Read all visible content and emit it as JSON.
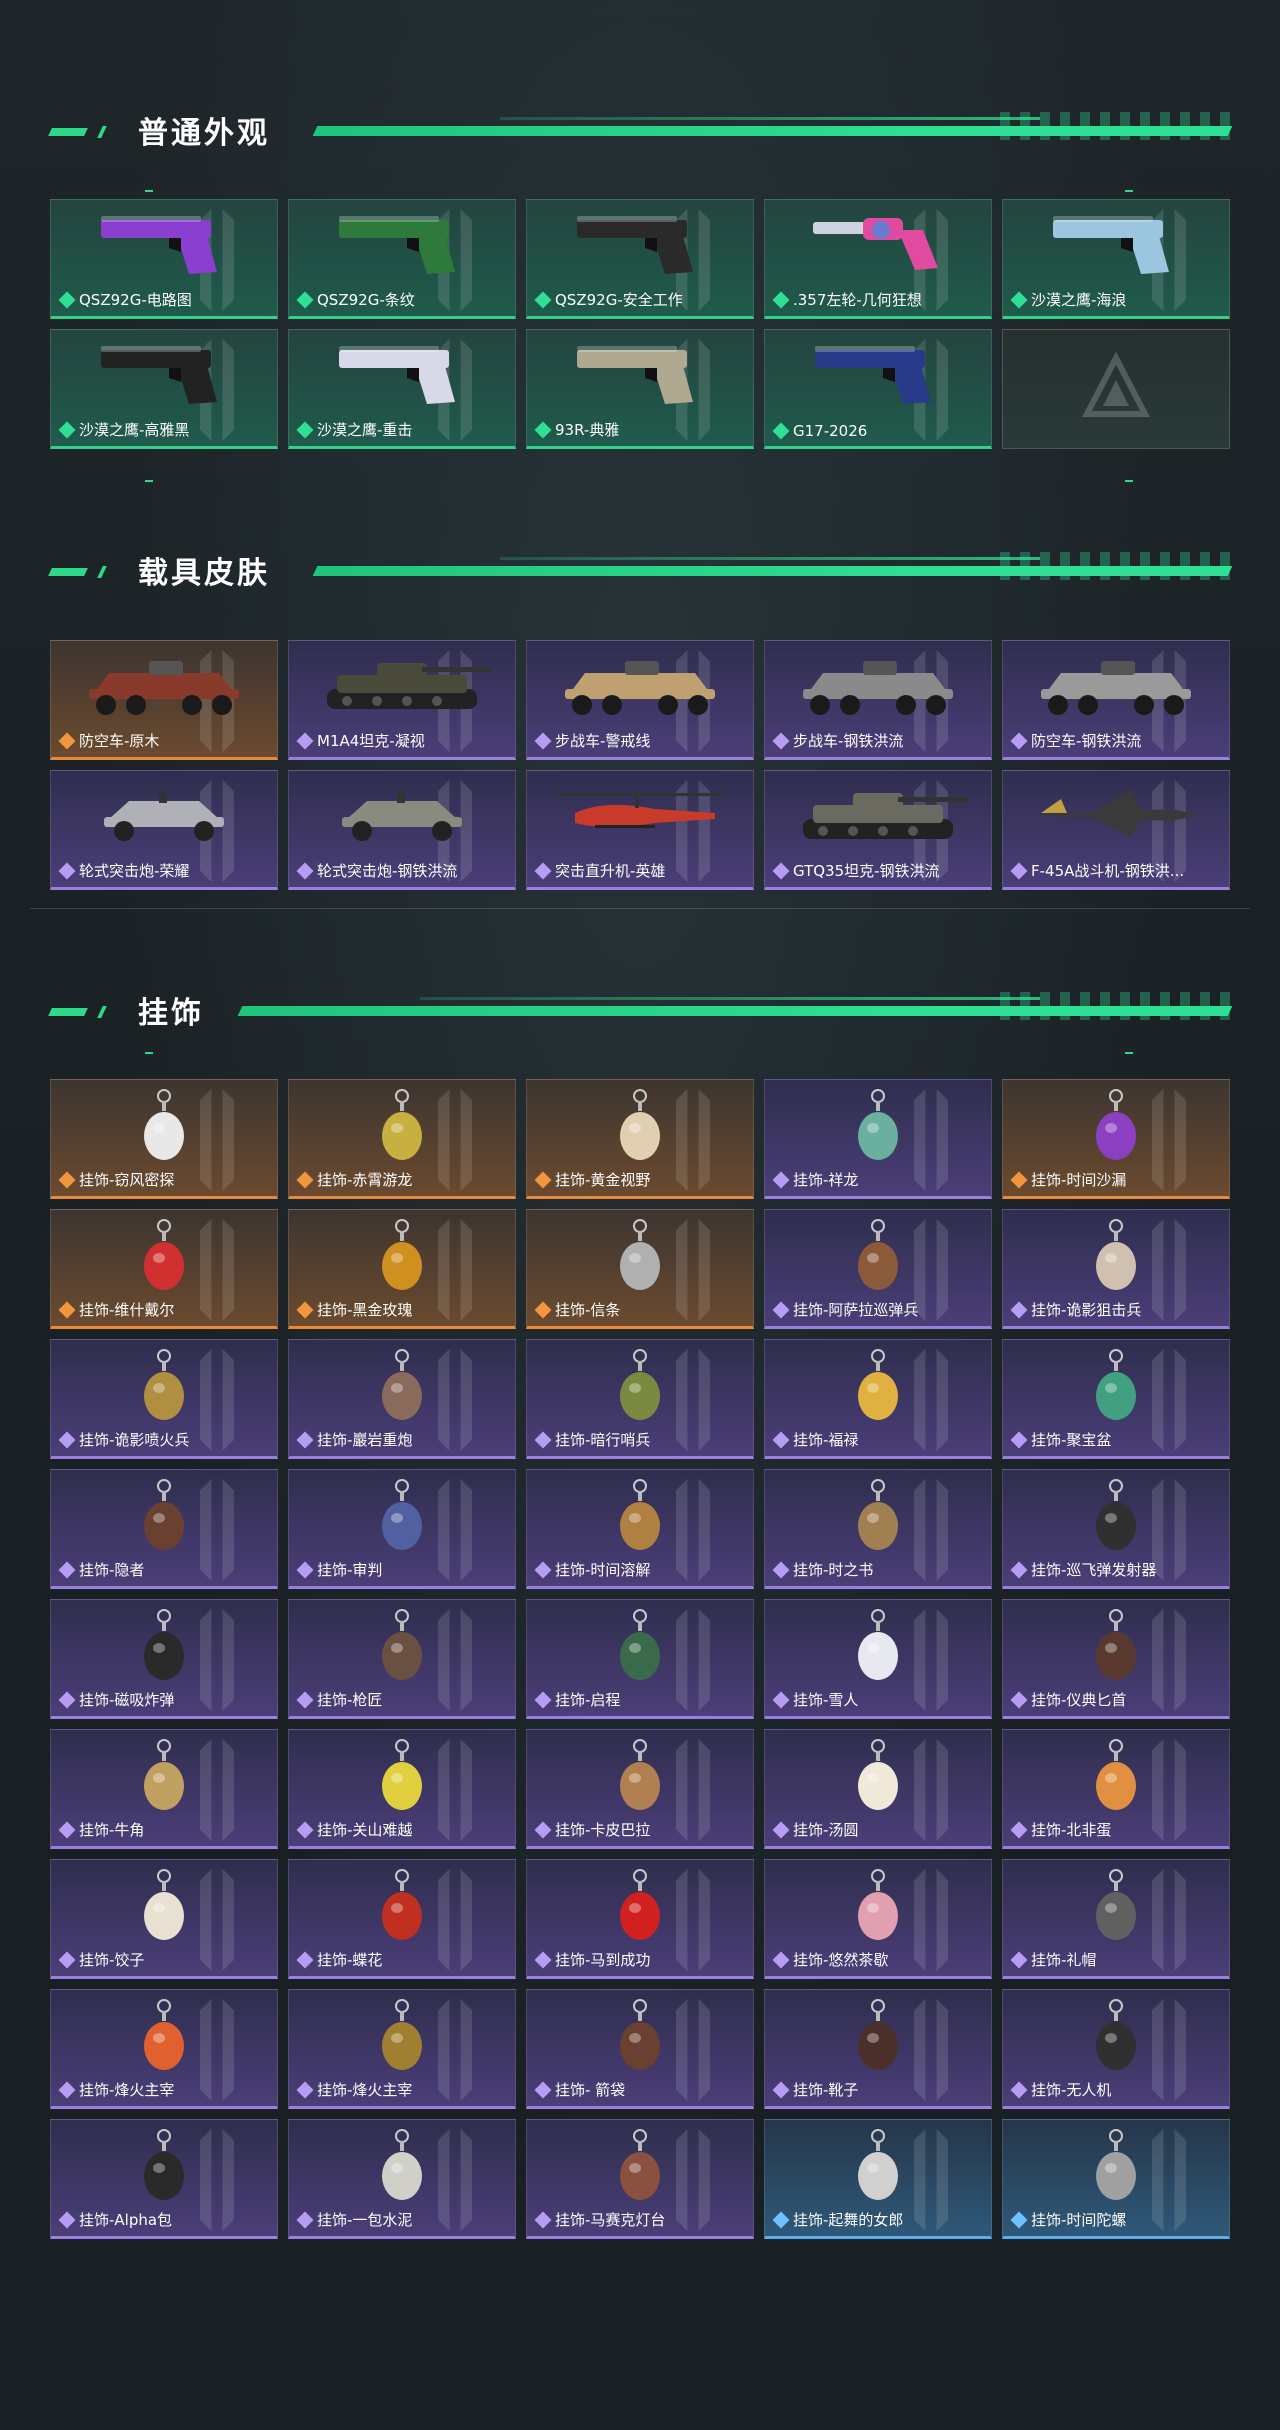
{
  "sections": [
    {
      "title": "普通外观"
    },
    {
      "title": "载具皮肤"
    },
    {
      "title": "挂饰"
    }
  ],
  "weapons": [
    {
      "name": "QSZ92G-电路图",
      "rarity": "green",
      "icon": "pistol-icon",
      "color": "#8a3fd0"
    },
    {
      "name": "QSZ92G-条纹",
      "rarity": "green",
      "icon": "pistol-icon",
      "color": "#2e7a3a"
    },
    {
      "name": "QSZ92G-安全工作",
      "rarity": "green",
      "icon": "pistol-icon",
      "color": "#2a2a2a"
    },
    {
      "name": ".357左轮-几何狂想",
      "rarity": "green",
      "icon": "revolver-icon",
      "color": "#e04aa0"
    },
    {
      "name": "沙漠之鹰-海浪",
      "rarity": "green",
      "icon": "pistol-icon",
      "color": "#9cc6e0"
    },
    {
      "name": "沙漠之鹰-高雅黑",
      "rarity": "green",
      "icon": "pistol-icon",
      "color": "#222222"
    },
    {
      "name": "沙漠之鹰-重击",
      "rarity": "green",
      "icon": "pistol-icon",
      "color": "#d8d8e8"
    },
    {
      "name": "93R-典雅",
      "rarity": "green",
      "icon": "pistol-icon",
      "color": "#b0a890"
    },
    {
      "name": "G17-2026",
      "rarity": "green",
      "icon": "pistol-icon",
      "color": "#2a3a8a"
    }
  ],
  "vehicles": [
    {
      "name": "防空车-原木",
      "rarity": "orange",
      "icon": "apc-icon",
      "color": "#8a3a2a"
    },
    {
      "name": "M1A4坦克-凝视",
      "rarity": "purple",
      "icon": "tank-icon",
      "color": "#4a4a3a"
    },
    {
      "name": "步战车-警戒线",
      "rarity": "purple",
      "icon": "apc-icon",
      "color": "#c0a070"
    },
    {
      "name": "步战车-钢铁洪流",
      "rarity": "purple",
      "icon": "apc-icon",
      "color": "#8a8a8a"
    },
    {
      "name": "防空车-钢铁洪流",
      "rarity": "purple",
      "icon": "apc-icon",
      "color": "#9a9a9a"
    },
    {
      "name": "轮式突击炮-荣耀",
      "rarity": "purple",
      "icon": "buggy-icon",
      "color": "#b0b0b8"
    },
    {
      "name": "轮式突击炮-钢铁洪流",
      "rarity": "purple",
      "icon": "buggy-icon",
      "color": "#8a8a80"
    },
    {
      "name": "突击直升机-英雄",
      "rarity": "purple",
      "icon": "helicopter-icon",
      "color": "#c83a2a"
    },
    {
      "name": "GTQ35坦克-钢铁洪流",
      "rarity": "purple",
      "icon": "tank-icon",
      "color": "#6a6a60"
    },
    {
      "name": "F-45A战斗机-钢铁洪...",
      "rarity": "purple",
      "icon": "jet-icon",
      "color": "#3a3a3a"
    }
  ],
  "charms": [
    {
      "name": "挂饰-窃风密探",
      "rarity": "orange",
      "color": "#e8e8e8"
    },
    {
      "name": "挂饰-赤霄游龙",
      "rarity": "orange",
      "color": "#c8b040"
    },
    {
      "name": "挂饰-黄金视野",
      "rarity": "orange",
      "color": "#e0d0b0"
    },
    {
      "name": "挂饰-祥龙",
      "rarity": "purple",
      "color": "#6ab0a0"
    },
    {
      "name": "挂饰-时间沙漏",
      "rarity": "orange",
      "color": "#8a40c0"
    },
    {
      "name": "挂饰-维什戴尔",
      "rarity": "orange",
      "color": "#d03030"
    },
    {
      "name": "挂饰-黑金玫瑰",
      "rarity": "orange",
      "color": "#d09020"
    },
    {
      "name": "挂饰-信条",
      "rarity": "orange",
      "color": "#b0b0b0"
    },
    {
      "name": "挂饰-阿萨拉巡弹兵",
      "rarity": "purple",
      "color": "#8a5a3a"
    },
    {
      "name": "挂饰-诡影狙击兵",
      "rarity": "purple",
      "color": "#d0c0b0"
    },
    {
      "name": "挂饰-诡影喷火兵",
      "rarity": "purple",
      "color": "#b09040"
    },
    {
      "name": "挂饰-巖岩重炮",
      "rarity": "purple",
      "color": "#8a6a5a"
    },
    {
      "name": "挂饰-暗行哨兵",
      "rarity": "purple",
      "color": "#7a8a40"
    },
    {
      "name": "挂饰-福禄",
      "rarity": "purple",
      "color": "#e0b040"
    },
    {
      "name": "挂饰-聚宝盆",
      "rarity": "purple",
      "color": "#40a080"
    },
    {
      "name": "挂饰-隐者",
      "rarity": "purple",
      "color": "#6a4030"
    },
    {
      "name": "挂饰-审判",
      "rarity": "purple",
      "color": "#5060a0"
    },
    {
      "name": "挂饰-时间溶解",
      "rarity": "purple",
      "color": "#b08040"
    },
    {
      "name": "挂饰-时之书",
      "rarity": "purple",
      "color": "#a08050"
    },
    {
      "name": "挂饰-巡飞弹发射器",
      "rarity": "purple",
      "color": "#303030"
    },
    {
      "name": "挂饰-磁吸炸弹",
      "rarity": "purple",
      "color": "#2a2a2a"
    },
    {
      "name": "挂饰-枪匠",
      "rarity": "purple",
      "color": "#6a5040"
    },
    {
      "name": "挂饰-启程",
      "rarity": "purple",
      "color": "#3a6a4a"
    },
    {
      "name": "挂饰-雪人",
      "rarity": "purple",
      "color": "#e8e8f0"
    },
    {
      "name": "挂饰-仪典匕首",
      "rarity": "purple",
      "color": "#5a3a30"
    },
    {
      "name": "挂饰-牛角",
      "rarity": "purple",
      "color": "#c0a060"
    },
    {
      "name": "挂饰-关山难越",
      "rarity": "purple",
      "color": "#e0d040"
    },
    {
      "name": "挂饰-卡皮巴拉",
      "rarity": "purple",
      "color": "#b08050"
    },
    {
      "name": "挂饰-汤圆",
      "rarity": "purple",
      "color": "#f0e8d8"
    },
    {
      "name": "挂饰-北非蛋",
      "rarity": "purple",
      "color": "#e09040"
    },
    {
      "name": "挂饰-饺子",
      "rarity": "purple",
      "color": "#e8e0d0"
    },
    {
      "name": "挂饰-蝶花",
      "rarity": "purple",
      "color": "#c03020"
    },
    {
      "name": "挂饰-马到成功",
      "rarity": "purple",
      "color": "#d02020"
    },
    {
      "name": "挂饰-悠然茶歇",
      "rarity": "purple",
      "color": "#e0a0b0"
    },
    {
      "name": "挂饰-礼帽",
      "rarity": "purple",
      "color": "#606060"
    },
    {
      "name": "挂饰-烽火主宰",
      "rarity": "purple",
      "color": "#e06030"
    },
    {
      "name": "挂饰-烽火主宰",
      "rarity": "purple",
      "color": "#a08030"
    },
    {
      "name": "挂饰- 箭袋",
      "rarity": "purple",
      "color": "#6a4030"
    },
    {
      "name": "挂饰-靴子",
      "rarity": "purple",
      "color": "#4a3028"
    },
    {
      "name": "挂饰-无人机",
      "rarity": "purple",
      "color": "#303030"
    },
    {
      "name": "挂饰-Alpha包",
      "rarity": "purple",
      "color": "#2a2a2a"
    },
    {
      "name": "挂饰-一包水泥",
      "rarity": "purple",
      "color": "#d0d0c8"
    },
    {
      "name": "挂饰-马赛克灯台",
      "rarity": "purple",
      "color": "#8a5040"
    },
    {
      "name": "挂饰-起舞的女郎",
      "rarity": "blue",
      "color": "#d0d0d0"
    },
    {
      "name": "挂饰-时间陀螺",
      "rarity": "blue",
      "color": "#a0a0a0"
    }
  ]
}
